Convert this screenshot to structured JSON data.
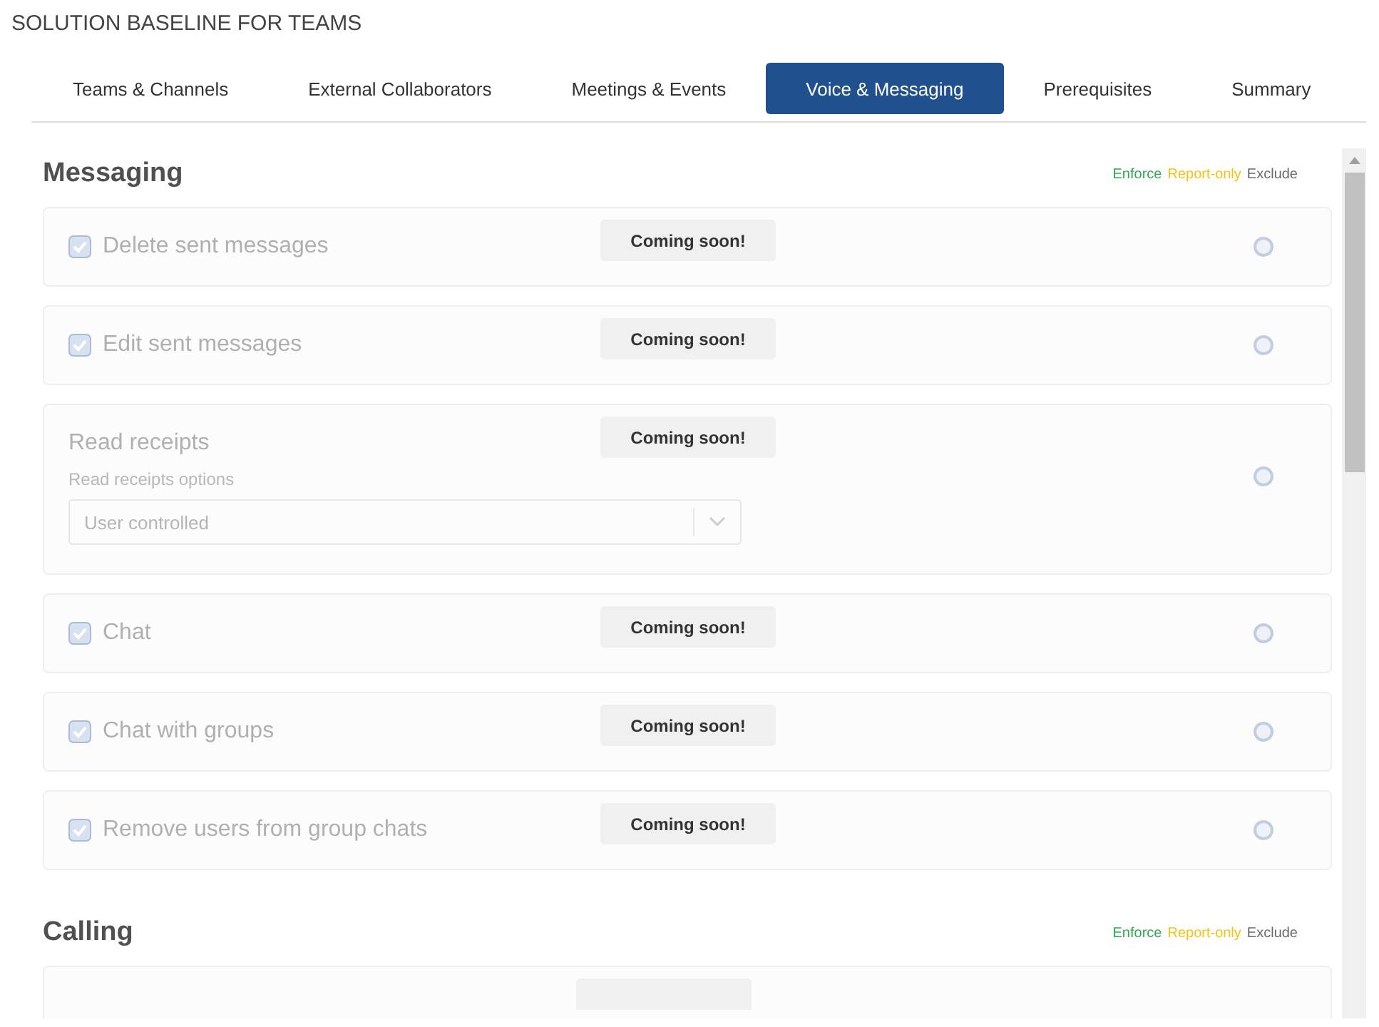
{
  "page_title": "SOLUTION BASELINE FOR TEAMS",
  "tabs": [
    {
      "label": "Teams & Channels",
      "selected": false
    },
    {
      "label": "External Collaborators",
      "selected": false
    },
    {
      "label": "Meetings & Events",
      "selected": false
    },
    {
      "label": "Voice & Messaging",
      "selected": true
    },
    {
      "label": "Prerequisites",
      "selected": false
    },
    {
      "label": "Summary",
      "selected": false
    }
  ],
  "sections": [
    {
      "title": "Messaging",
      "legend": [
        {
          "label": "Enforce",
          "color": "#2fa84f"
        },
        {
          "label": "Report-only",
          "color": "#f5c211"
        },
        {
          "label": "Exclude",
          "color": "#6b6b6b"
        }
      ],
      "settings": [
        {
          "kind": "checkbox",
          "label": "Delete sent messages",
          "checked": true,
          "badge": "Coming soon!",
          "radio_selected": false
        },
        {
          "kind": "checkbox",
          "label": "Edit sent messages",
          "checked": true,
          "badge": "Coming soon!",
          "radio_selected": false
        },
        {
          "kind": "dropdown",
          "label": "Read receipts",
          "field_label": "Read receipts options",
          "value": "User controlled",
          "badge": "Coming soon!",
          "radio_selected": false
        },
        {
          "kind": "checkbox",
          "label": "Chat",
          "checked": true,
          "badge": "Coming soon!",
          "radio_selected": false
        },
        {
          "kind": "checkbox",
          "label": "Chat with groups",
          "checked": true,
          "badge": "Coming soon!",
          "radio_selected": false
        },
        {
          "kind": "checkbox",
          "label": "Remove users from group chats",
          "checked": true,
          "badge": "Coming soon!",
          "radio_selected": false
        }
      ]
    },
    {
      "title": "Calling",
      "legend": [
        {
          "label": "Enforce",
          "color": "#2fa84f"
        },
        {
          "label": "Report-only",
          "color": "#f5c211"
        },
        {
          "label": "Exclude",
          "color": "#6b6b6b"
        }
      ],
      "settings": [
        {
          "kind": "cut"
        }
      ]
    }
  ]
}
